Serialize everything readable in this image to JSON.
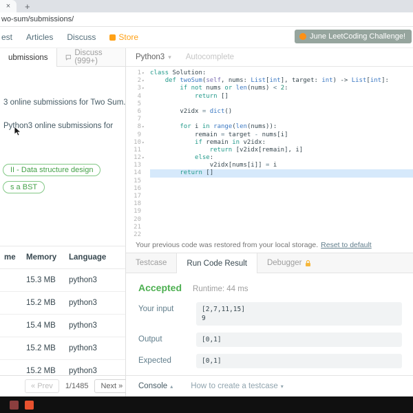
{
  "browser": {
    "close_tab": "×",
    "new_tab": "+",
    "url": "wo-sum/submissions/"
  },
  "nav": {
    "items": [
      "est",
      "Articles",
      "Discuss"
    ],
    "store_label": "Store",
    "challenge_label": "June LeetCoding Challenge!"
  },
  "left_panel": {
    "tabs": {
      "submissions": "ubmissions",
      "discuss": "Discuss (999+)"
    },
    "beats_line1": "3 online submissions for Two Sum.",
    "beats_line2": "Python3 online submissions for",
    "pills": [
      "II - Data structure design",
      "s a BST"
    ],
    "table": {
      "headers": [
        "me",
        "Memory",
        "Language"
      ],
      "rows": [
        {
          "runtime": "",
          "memory": "15.3 MB",
          "language": "python3"
        },
        {
          "runtime": "",
          "memory": "15.2 MB",
          "language": "python3"
        },
        {
          "runtime": "",
          "memory": "15.4 MB",
          "language": "python3"
        },
        {
          "runtime": "",
          "memory": "15.2 MB",
          "language": "python3"
        },
        {
          "runtime": "",
          "memory": "15.2 MB",
          "language": "python3"
        }
      ]
    },
    "pagination": {
      "prev_icon": "«",
      "prev": "Prev",
      "page": "1/1485",
      "next": "Next",
      "next_icon": "»"
    }
  },
  "editor": {
    "language": "Python3",
    "caret": "▾",
    "autocomplete": "Autocomplete",
    "restore_note": "Your previous code was restored from your local storage.",
    "reset_link": "Reset to default",
    "lines": [
      {
        "n": 1,
        "fold": true,
        "tokens": [
          [
            "kw",
            "class"
          ],
          [
            "pl",
            " Solution:"
          ]
        ]
      },
      {
        "n": 2,
        "fold": true,
        "tokens": [
          [
            "pl",
            "    "
          ],
          [
            "kw",
            "def"
          ],
          [
            "pl",
            " "
          ],
          [
            "fn",
            "twoSum"
          ],
          [
            "pl",
            "("
          ],
          [
            "slf",
            "self"
          ],
          [
            "pl",
            ", nums: "
          ],
          [
            "ty",
            "List"
          ],
          [
            "pl",
            "["
          ],
          [
            "ty",
            "int"
          ],
          [
            "pl",
            "], target: "
          ],
          [
            "ty",
            "int"
          ],
          [
            "pl",
            ") -> "
          ],
          [
            "ty",
            "List"
          ],
          [
            "pl",
            "["
          ],
          [
            "ty",
            "int"
          ],
          [
            "pl",
            "]:"
          ]
        ]
      },
      {
        "n": 3,
        "fold": true,
        "tokens": [
          [
            "pl",
            "        "
          ],
          [
            "kw",
            "if"
          ],
          [
            "pl",
            " "
          ],
          [
            "kw",
            "not"
          ],
          [
            "pl",
            " nums "
          ],
          [
            "kw",
            "or"
          ],
          [
            "pl",
            " "
          ],
          [
            "bi",
            "len"
          ],
          [
            "pl",
            "(nums) "
          ],
          [
            "op",
            "<"
          ],
          [
            "pl",
            " "
          ],
          [
            "num",
            "2"
          ],
          [
            "pl",
            ":"
          ]
        ]
      },
      {
        "n": 4,
        "tokens": [
          [
            "pl",
            "            "
          ],
          [
            "kw",
            "return"
          ],
          [
            "pl",
            " []"
          ]
        ]
      },
      {
        "n": 5,
        "tokens": []
      },
      {
        "n": 6,
        "tokens": [
          [
            "pl",
            "        v2idx "
          ],
          [
            "op",
            "="
          ],
          [
            "pl",
            " "
          ],
          [
            "bi",
            "dict"
          ],
          [
            "pl",
            "()"
          ]
        ]
      },
      {
        "n": 7,
        "tokens": []
      },
      {
        "n": 8,
        "fold": true,
        "tokens": [
          [
            "pl",
            "        "
          ],
          [
            "kw",
            "for"
          ],
          [
            "pl",
            " i "
          ],
          [
            "kw",
            "in"
          ],
          [
            "pl",
            " "
          ],
          [
            "bi",
            "range"
          ],
          [
            "pl",
            "("
          ],
          [
            "bi",
            "len"
          ],
          [
            "pl",
            "(nums)):"
          ]
        ]
      },
      {
        "n": 9,
        "tokens": [
          [
            "pl",
            "            remain "
          ],
          [
            "op",
            "="
          ],
          [
            "pl",
            " target "
          ],
          [
            "op",
            "-"
          ],
          [
            "pl",
            " nums[i]"
          ]
        ]
      },
      {
        "n": 10,
        "fold": true,
        "tokens": [
          [
            "pl",
            "            "
          ],
          [
            "kw",
            "if"
          ],
          [
            "pl",
            " remain "
          ],
          [
            "kw",
            "in"
          ],
          [
            "pl",
            " v2idx:"
          ]
        ]
      },
      {
        "n": 11,
        "tokens": [
          [
            "pl",
            "                "
          ],
          [
            "kw",
            "return"
          ],
          [
            "pl",
            " [v2idx[remain], i]"
          ]
        ]
      },
      {
        "n": 12,
        "fold": true,
        "tokens": [
          [
            "pl",
            "            "
          ],
          [
            "kw",
            "else"
          ],
          [
            "pl",
            ":"
          ]
        ]
      },
      {
        "n": 13,
        "tokens": [
          [
            "pl",
            "                v2idx[nums[i]] "
          ],
          [
            "op",
            "="
          ],
          [
            "pl",
            " i"
          ]
        ]
      },
      {
        "n": 14,
        "active": true,
        "tokens": [
          [
            "pl",
            "        "
          ],
          [
            "kw",
            "return"
          ],
          [
            "pl",
            " []"
          ]
        ]
      },
      {
        "n": 15,
        "tokens": []
      },
      {
        "n": 16,
        "tokens": []
      },
      {
        "n": 17,
        "tokens": []
      },
      {
        "n": 18,
        "tokens": []
      },
      {
        "n": 19,
        "tokens": []
      },
      {
        "n": 20,
        "tokens": []
      },
      {
        "n": 21,
        "tokens": []
      },
      {
        "n": 22,
        "tokens": []
      }
    ]
  },
  "console": {
    "tabs": {
      "testcase": "Testcase",
      "run_result": "Run Code Result",
      "debugger": "Debugger"
    },
    "status": "Accepted",
    "runtime": "Runtime: 44 ms",
    "io": [
      {
        "label": "Your input",
        "value": "[2,7,11,15]\n9"
      },
      {
        "label": "Output",
        "value": "[0,1]"
      },
      {
        "label": "Expected",
        "value": "[0,1]"
      }
    ],
    "footer": {
      "console": "Console",
      "console_caret": "▴",
      "howto": "How to create a testcase",
      "howto_caret": "▾"
    }
  },
  "colors": {
    "accent_green": "#4caf50",
    "store_orange": "#ffa116",
    "accepted_green": "#4caf50"
  }
}
